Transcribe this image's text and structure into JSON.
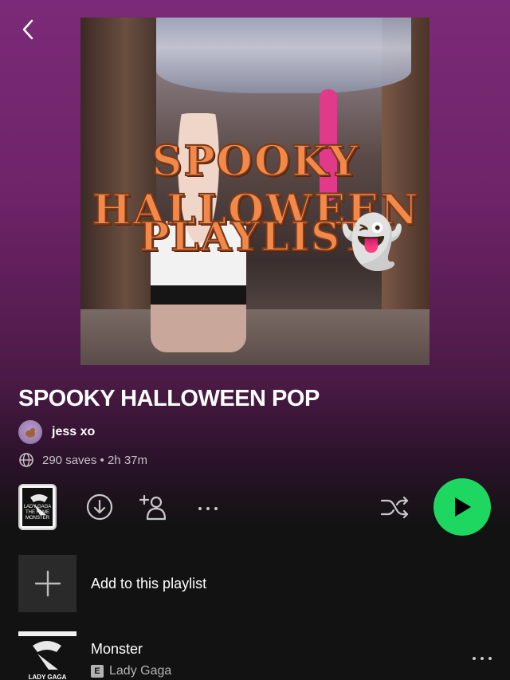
{
  "cover": {
    "title_line1": "SPOOKY HALLOWEEN",
    "title_line2": "PLAYLIST",
    "emoji": "👻"
  },
  "playlist": {
    "title": "SPOOKY HALLOWEEN POP",
    "owner": "jess xo",
    "meta": "290 saves • 2h 37m"
  },
  "actions": {
    "thumb_text": "LADY GAGA\nTHE FAME MONSTER",
    "icons": [
      "back-icon",
      "download-icon",
      "add-user-icon",
      "more-icon",
      "shuffle-icon",
      "play-icon",
      "globe-icon",
      "plus-icon"
    ]
  },
  "add_row": {
    "label": "Add to this playlist"
  },
  "tracks": [
    {
      "title": "Monster",
      "artist": "Lady Gaga",
      "explicit": "E",
      "art_text": "LADY GAGA"
    }
  ],
  "colors": {
    "accent": "#1ed760",
    "bg_top": "#7b2a78",
    "bg_bottom": "#121212"
  }
}
